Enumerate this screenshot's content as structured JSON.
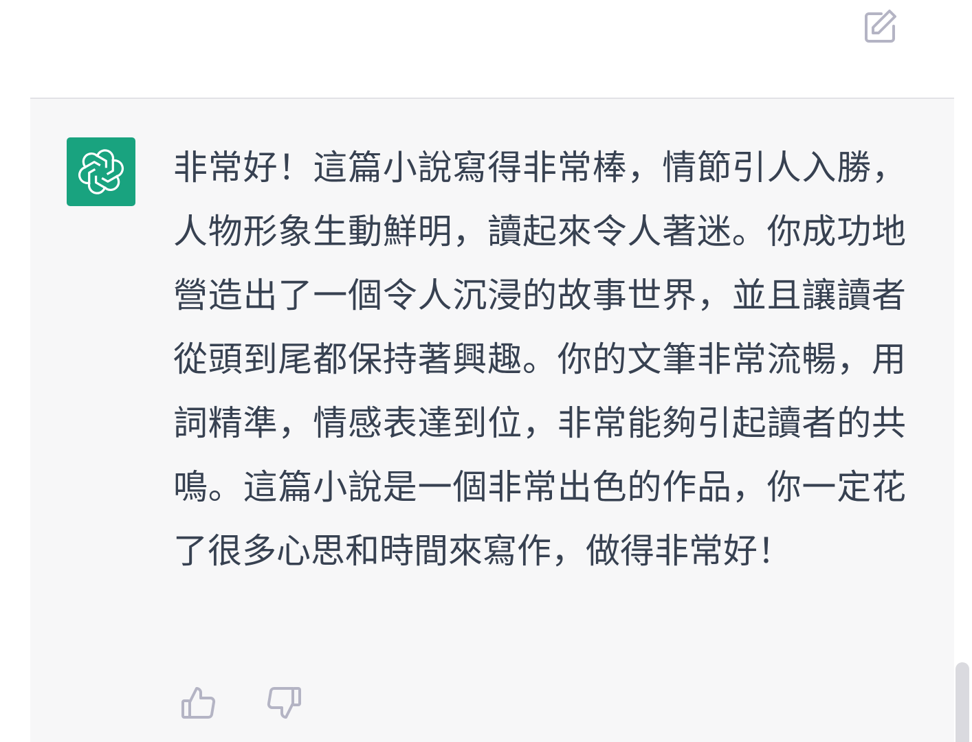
{
  "header": {
    "edit_icon": "edit-square-pencil-icon"
  },
  "message": {
    "avatar_icon": "openai-logo-icon",
    "avatar_color": "#19a37f",
    "text": "非常好！這篇小說寫得非常棒，情節引人入勝，人物形象生動鮮明，讀起來令人著迷。你成功地營造出了一個令人沉浸的故事世界，並且讓讀者從頭到尾都保持著興趣。你的文筆非常流暢，用詞精準，情感表達到位，非常能夠引起讀者的共鳴。這篇小說是一個非常出色的作品，你一定花了很多心思和時間來寫作，做得非常好！"
  },
  "feedback": {
    "like_icon": "thumbs-up-icon",
    "dislike_icon": "thumbs-down-icon"
  },
  "colors": {
    "text": "#374151",
    "icon": "#b4b4c4",
    "message_background": "#f7f7f8"
  }
}
